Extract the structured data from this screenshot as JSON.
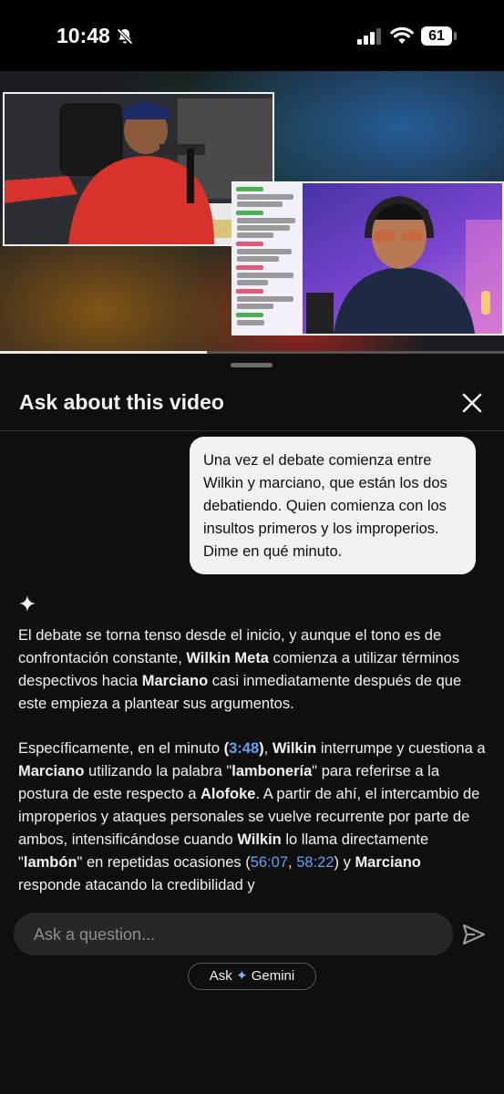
{
  "status_bar": {
    "time": "10:48",
    "battery": "61",
    "icons": [
      "bell-slash-icon",
      "signal-icon",
      "wifi-icon",
      "battery-icon"
    ]
  },
  "video": {
    "progress_fraction": 0.41
  },
  "sheet": {
    "title": "Ask about this video",
    "close_icon": "close-icon"
  },
  "conversation": {
    "user_message": "Una vez el debate comienza entre Wilkin y marciano, que están los dos debatiendo. Quien comienza con los insultos primeros y los improperios. Dime en qué minuto.",
    "assistant_icon": "sparkle-icon",
    "answer": {
      "p1": {
        "t1": "El debate se torna tenso desde el inicio, y aunque el tono es de confrontación constante, ",
        "b1": "Wilkin Meta",
        "t2": " comienza a utilizar términos despectivos hacia ",
        "b2": "Marciano",
        "t3": " casi inmediatamente después de que este empieza a plantear sus argumentos."
      },
      "p2": {
        "t1": "Específicamente, en el minuto ",
        "b1_open": "(",
        "ts1": "3:48",
        "b1_close": ")",
        "t2": ", ",
        "b2": "Wilkin",
        "t3": " interrumpe y cuestiona a ",
        "b3": "Marciano",
        "t4": " utilizando la palabra \"",
        "b4": "lambonería",
        "t5": "\" para referirse a la postura de este respecto a ",
        "b5": "Alofoke",
        "t6": ". A partir de ahí, el intercambio de improperios y ataques personales se vuelve recurrente por parte de ambos, intensificándose cuando ",
        "b6": "Wilkin",
        "t7": " lo llama directamente \"",
        "b7": "lambón",
        "t8": "\" en repetidas ocasiones (",
        "ts2": "56:07",
        "t9": ", ",
        "ts3": "58:22",
        "t10": ") y ",
        "b8": "Marciano",
        "t11": " responde atacando la credibilidad y"
      }
    }
  },
  "input": {
    "placeholder": "Ask a question...",
    "send_icon": "send-icon"
  },
  "gemini_button": {
    "prefix": "Ask",
    "star": "✦",
    "suffix": "Gemini"
  },
  "colors": {
    "background": "#0f0f0f",
    "bubble": "#f1f1f1",
    "link": "#5aa4f5",
    "field": "#272727"
  }
}
